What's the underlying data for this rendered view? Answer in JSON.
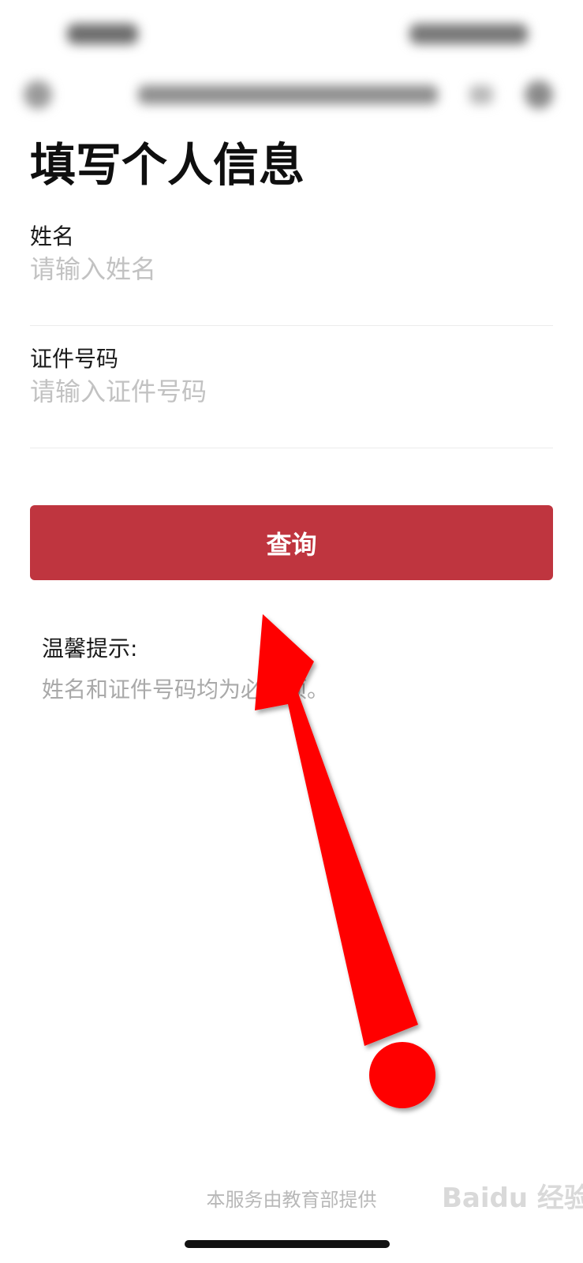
{
  "page": {
    "title": "填写个人信息"
  },
  "form": {
    "name_label": "姓名",
    "name_placeholder": "请输入姓名",
    "name_value": "",
    "id_label": "证件号码",
    "id_placeholder": "请输入证件号码",
    "id_value": ""
  },
  "query_button_label": "查询",
  "tips": {
    "title": "温馨提示:",
    "text": "姓名和证件号码均为必填项。"
  },
  "footer": {
    "provider": "本服务由教育部提供"
  },
  "watermark": {
    "text": "Baidu 经验"
  },
  "colors": {
    "button": "#bf353f",
    "arrow": "#ff0000",
    "placeholder": "#c2c2c2"
  },
  "icons": {
    "nav_back": "back-icon",
    "nav_more": "more-icon",
    "nav_close": "close-icon"
  }
}
